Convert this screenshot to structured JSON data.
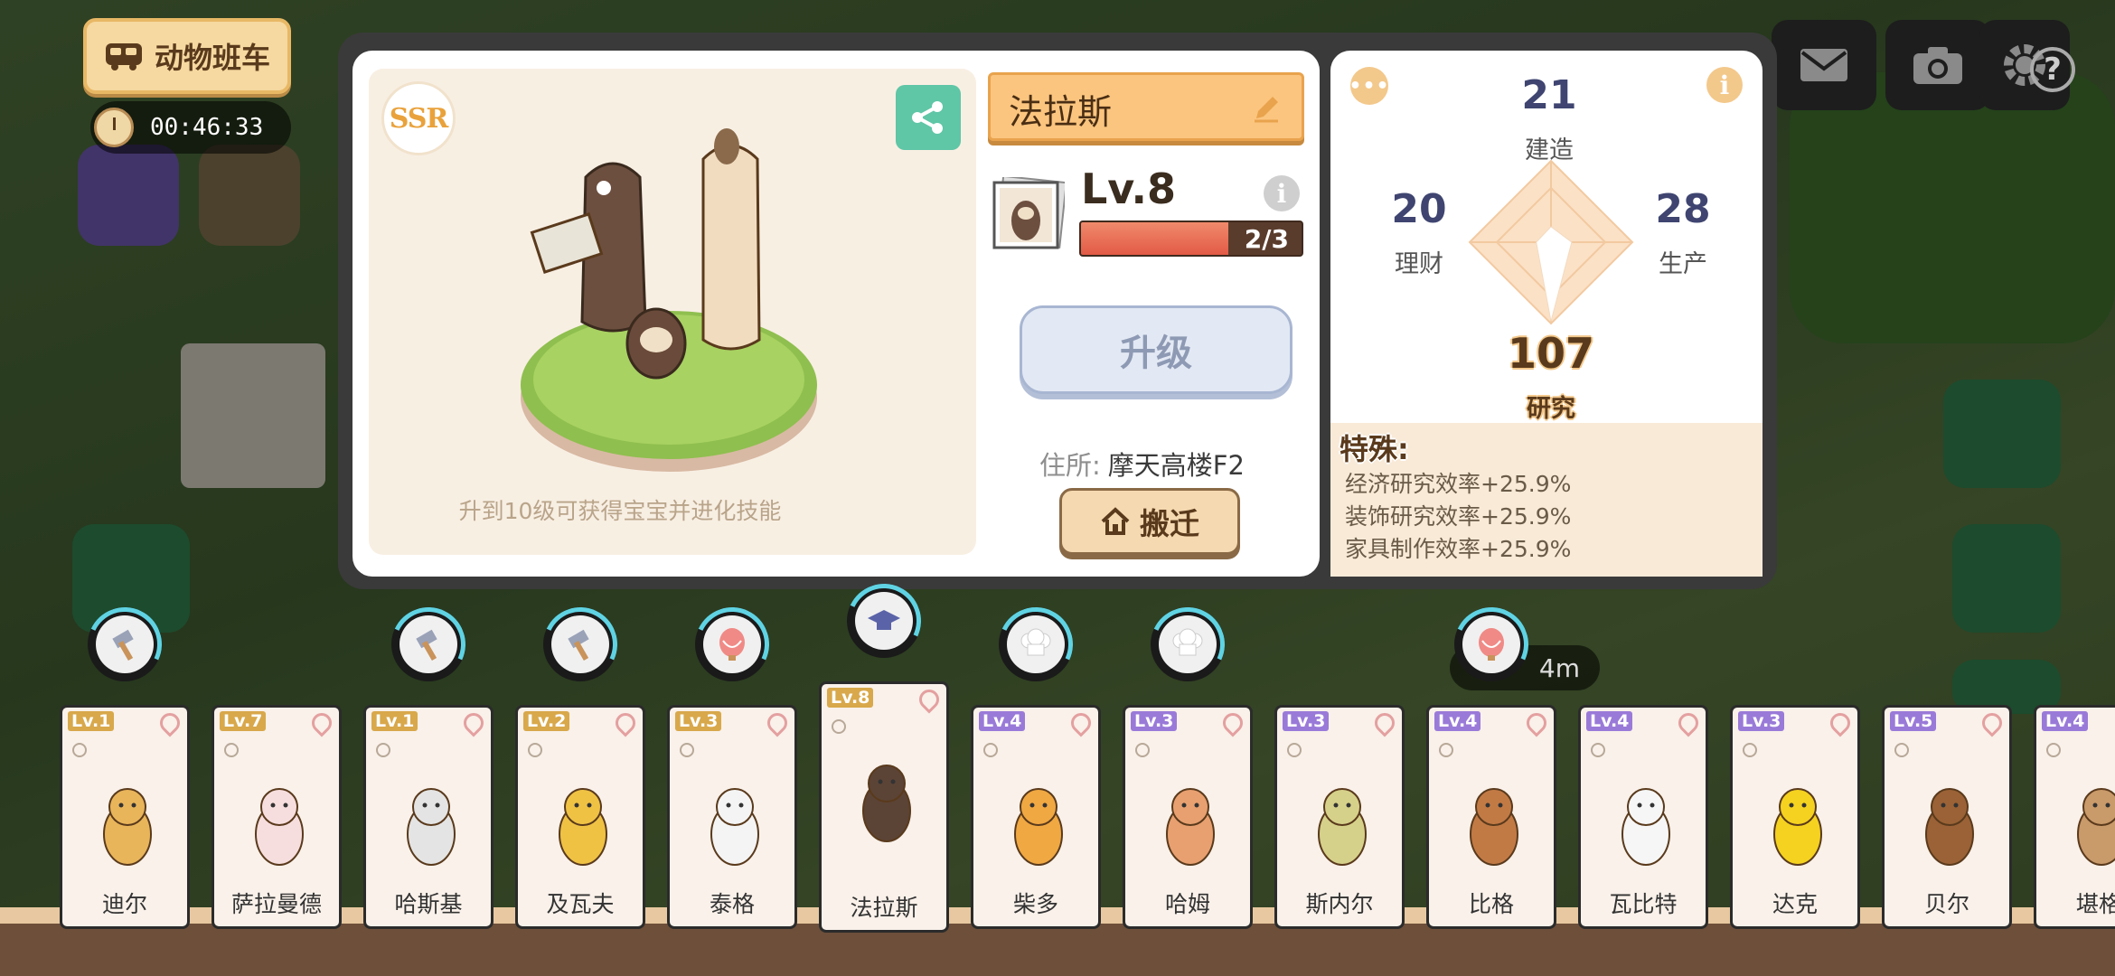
{
  "hud": {
    "bus_label": "动物班车",
    "timer": "00:46:33",
    "time_pill": "4m"
  },
  "profile": {
    "rarity": "SSR",
    "name": "法拉斯",
    "level": "Lv.8",
    "exp_text": "2/3",
    "exp_fraction": 0.667,
    "upgrade_label": "升级",
    "residence_label": "住所:",
    "residence_value": "摩天高楼F2",
    "move_label": "搬迁",
    "hint": "升到10级可获得宝宝并进化技能"
  },
  "stats": {
    "build_value": "21",
    "build_label": "建造",
    "finance_value": "20",
    "finance_label": "理财",
    "produce_value": "28",
    "produce_label": "生产",
    "research_value": "107",
    "research_label": "研究"
  },
  "special": {
    "title": "特殊:",
    "perks": [
      "经济研究效率+25.9%",
      "装饰研究效率+25.9%",
      "家具制作效率+25.9%"
    ]
  },
  "colors": {
    "accent_orange": "#fbc57f",
    "share_green": "#5fc6a6",
    "exp_red": "#e25a45",
    "upgrade_blue": "#e3e9f4"
  },
  "roster": [
    {
      "level": "Lv.1",
      "name": "迪尔",
      "badge": "hammer",
      "lv_color": "gold",
      "color": "#e9b55a"
    },
    {
      "level": "Lv.7",
      "name": "萨拉曼德",
      "badge": "",
      "lv_color": "gold",
      "color": "#f7dede"
    },
    {
      "level": "Lv.1",
      "name": "哈斯基",
      "badge": "hammer",
      "lv_color": "gold",
      "color": "#e4e4e4"
    },
    {
      "level": "Lv.2",
      "name": "及瓦夫",
      "badge": "hammer",
      "lv_color": "gold",
      "color": "#f0c244"
    },
    {
      "level": "Lv.3",
      "name": "泰格",
      "badge": "balloon",
      "lv_color": "gold",
      "color": "#f4f4f4"
    },
    {
      "level": "Lv.8",
      "name": "法拉斯",
      "badge": "graduation-cap",
      "lv_color": "gold",
      "color": "#5b4436",
      "selected": true
    },
    {
      "level": "Lv.4",
      "name": "柴多",
      "badge": "chef-hat",
      "lv_color": "purple",
      "color": "#f0a842"
    },
    {
      "level": "Lv.3",
      "name": "哈姆",
      "badge": "chef-hat",
      "lv_color": "purple",
      "color": "#e8a070"
    },
    {
      "level": "Lv.3",
      "name": "斯内尔",
      "badge": "",
      "lv_color": "purple",
      "color": "#d6d18a"
    },
    {
      "level": "Lv.4",
      "name": "比格",
      "badge": "balloon",
      "lv_color": "purple",
      "color": "#c27a45"
    },
    {
      "level": "Lv.4",
      "name": "瓦比特",
      "badge": "",
      "lv_color": "purple",
      "color": "#f6f6f6"
    },
    {
      "level": "Lv.3",
      "name": "达克",
      "badge": "",
      "lv_color": "purple",
      "color": "#f5d21f"
    },
    {
      "level": "Lv.5",
      "name": "贝尔",
      "badge": "",
      "lv_color": "purple",
      "color": "#9a6236"
    },
    {
      "level": "Lv.4",
      "name": "堪格",
      "badge": "",
      "lv_color": "purple",
      "color": "#c99a6a"
    }
  ]
}
